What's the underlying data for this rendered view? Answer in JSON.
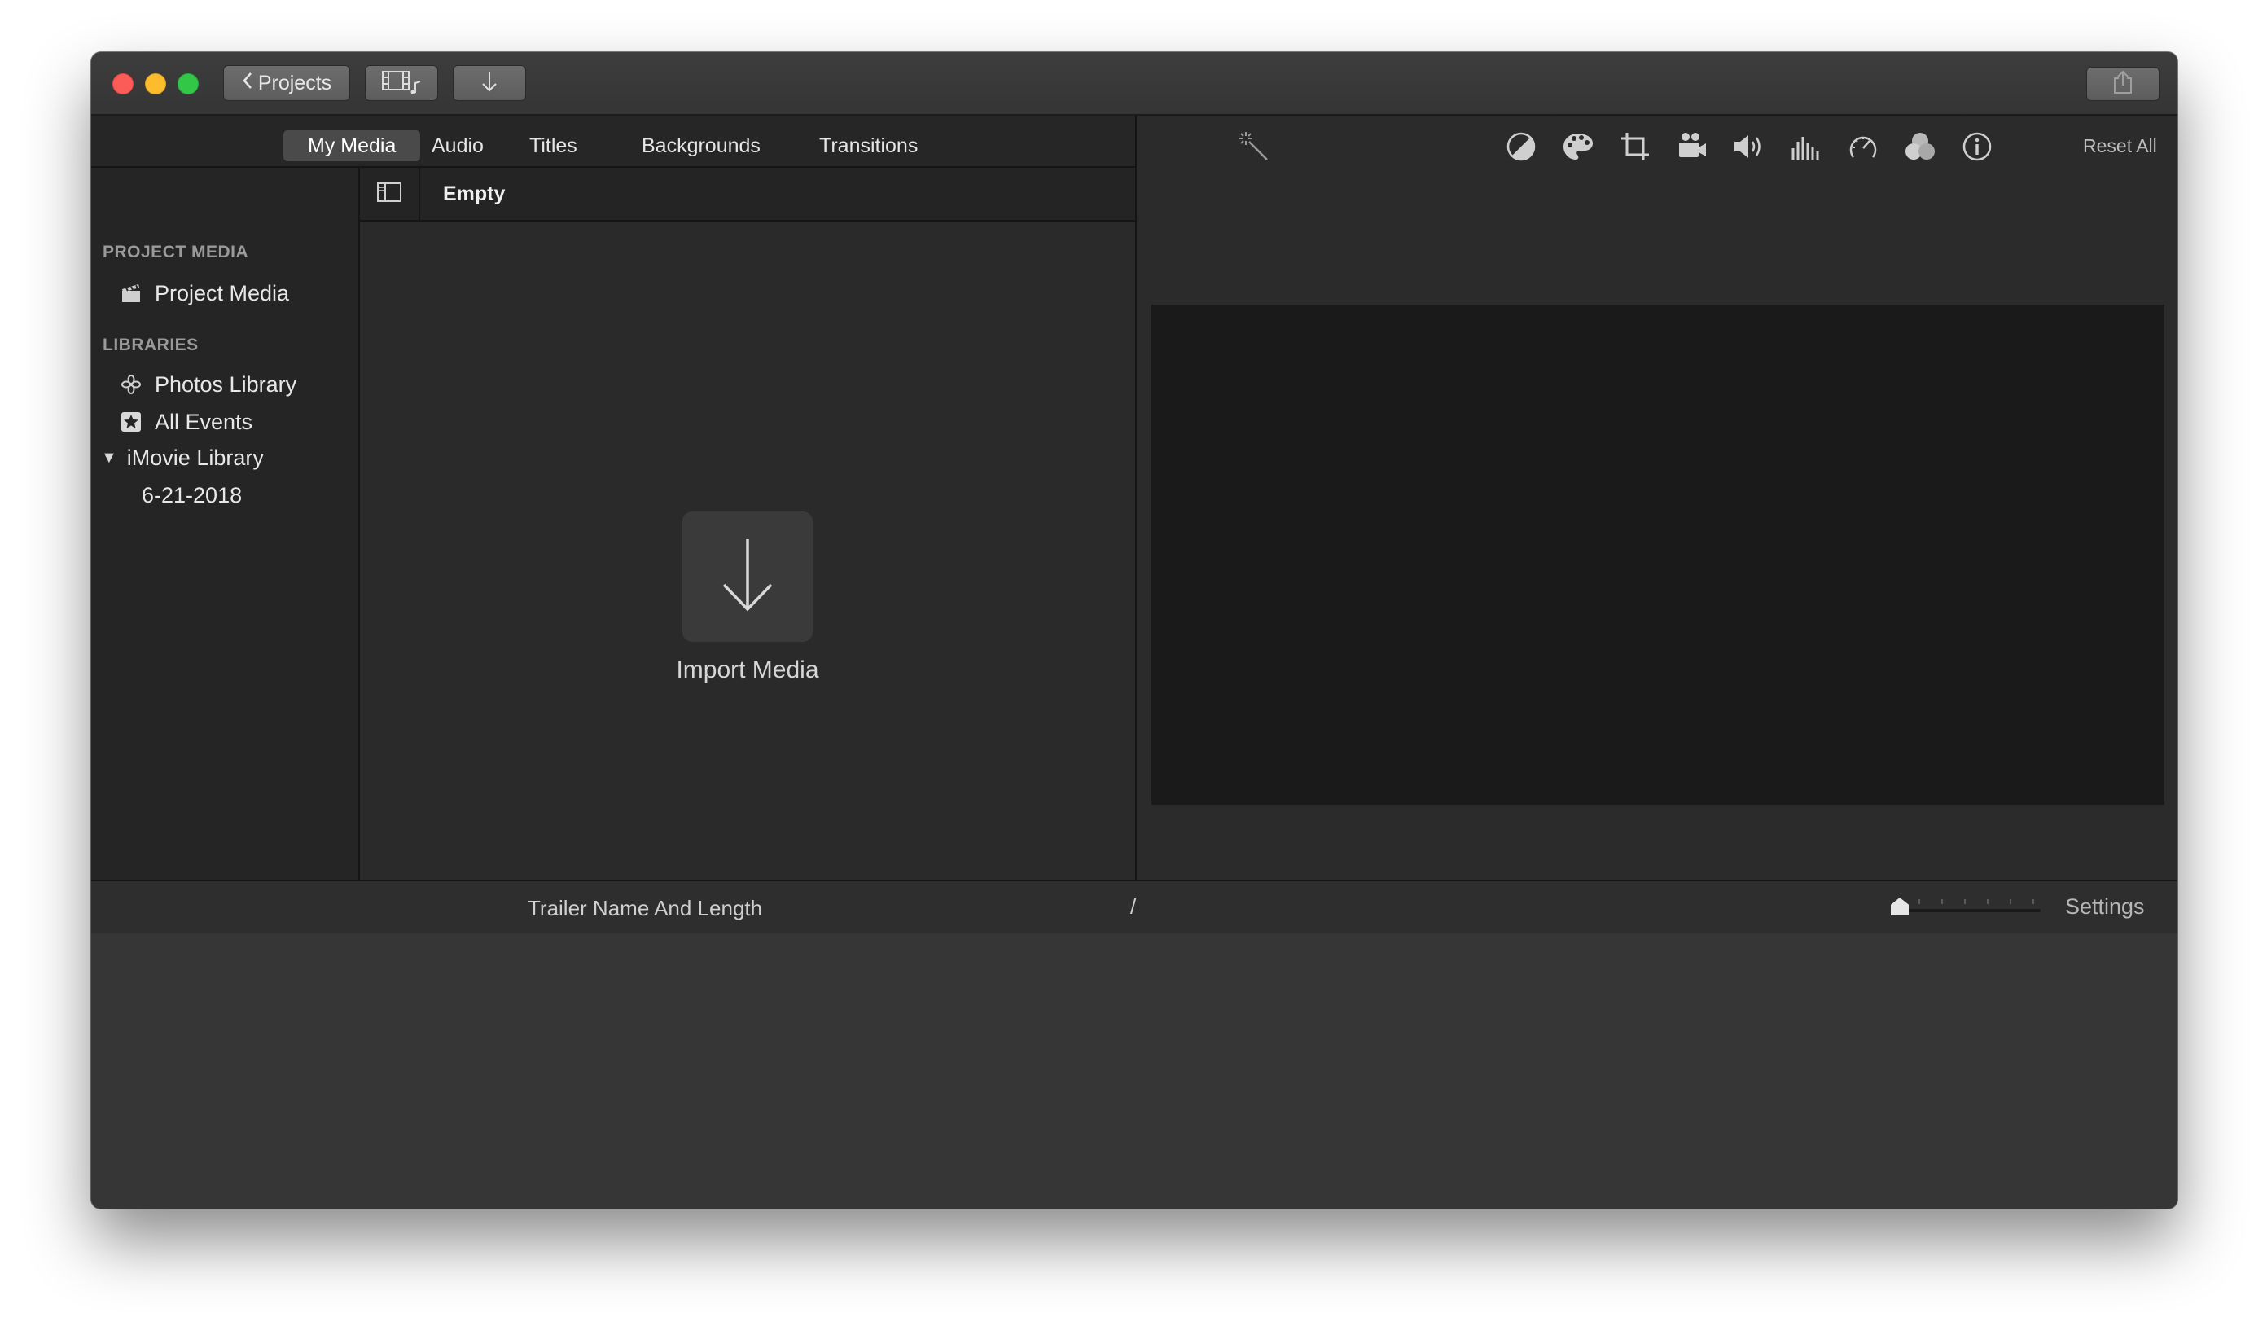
{
  "titlebar": {
    "projects_label": "Projects"
  },
  "browser": {
    "tabs": [
      {
        "label": "My Media"
      },
      {
        "label": "Audio"
      },
      {
        "label": "Titles"
      },
      {
        "label": "Backgrounds"
      },
      {
        "label": "Transitions"
      }
    ],
    "active_tab": "My Media"
  },
  "sidebar": {
    "project_media_heading": "PROJECT MEDIA",
    "project_media_item": "Project Media",
    "libraries_heading": "LIBRARIES",
    "photos_library": "Photos Library",
    "all_events": "All Events",
    "imovie_library": "iMovie Library",
    "event_date": "6-21-2018"
  },
  "content": {
    "filter_label": "Empty",
    "import_label": "Import Media"
  },
  "viewer": {
    "tools": [
      "magic-wand-icon",
      "color-balance-icon",
      "color-correction-icon",
      "crop-icon",
      "stabilization-icon",
      "volume-icon",
      "equalizer-icon",
      "speed-icon",
      "clip-filter-icon",
      "info-icon"
    ],
    "reset_label": "Reset All"
  },
  "timeline": {
    "trailer_label": "Trailer Name And Length",
    "slash": "/",
    "settings_label": "Settings"
  },
  "colors": {
    "window_bg": "#2b2b2b",
    "preview_bg": "#1a1a1a",
    "timeline_bg": "#363636",
    "close": "#fc5c57",
    "minimize": "#fdbc2e",
    "zoom": "#33c748"
  }
}
